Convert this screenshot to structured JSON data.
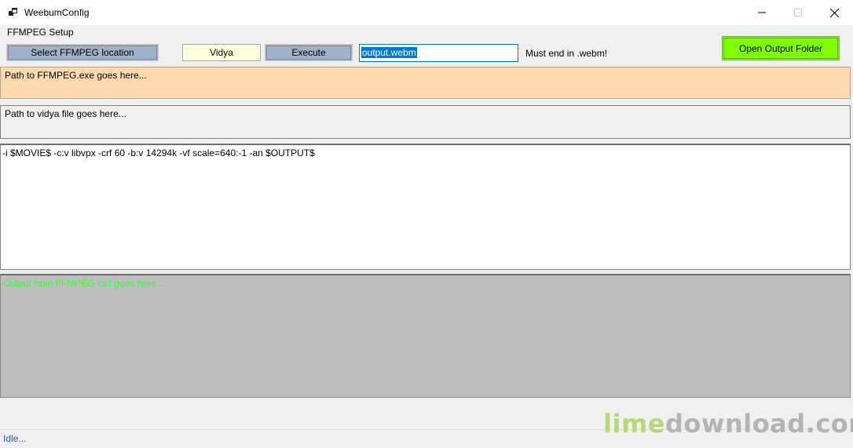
{
  "window": {
    "title": "WeebumConfig"
  },
  "setup": {
    "group_label": "FFMPEG Setup",
    "select_ffmpeg_label": "Select FFMPEG location",
    "vidya_label": "Vidya",
    "execute_label": "Execute",
    "output_name_value": "output.webm",
    "output_hint": "Must end in .webm!",
    "open_output_label": "Open Output Folder"
  },
  "panels": {
    "ffmpeg_path": "Path to FFMPEG.exe goes here...",
    "vidya_path": "Path to vidya file goes here...",
    "arguments": "-i $MOVIE$ -c:v libvpx -crf 60 -b:v 14294k -vf scale=640:-1 -an $OUTPUT$",
    "ffmpeg_output": "Output from FFMPEG call goes here..."
  },
  "status": {
    "text": "Idle..."
  },
  "watermark": {
    "part1": "lime",
    "part2": "download.com"
  },
  "colors": {
    "button_blue": "#a1b1c9",
    "vidya_button": "#ffffe0",
    "open_output_button": "#80ff00",
    "ffmpeg_path_bg": "#ffdab0",
    "output_panel_bg": "#bebebe",
    "output_text": "#33ff33",
    "selection": "#0078d7"
  }
}
